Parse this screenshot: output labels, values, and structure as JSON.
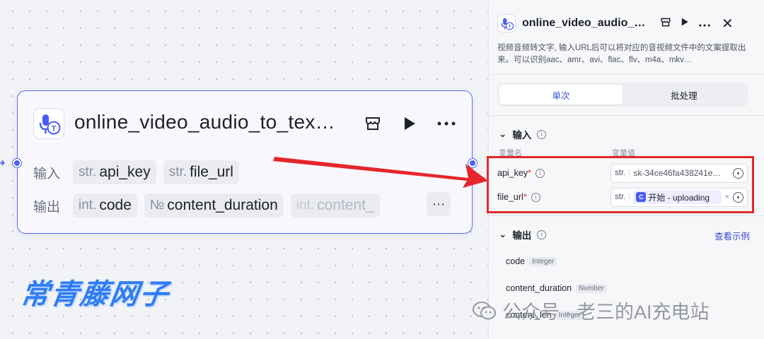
{
  "node": {
    "title": "online_video_audio_to_tex…",
    "input_label": "输入",
    "output_label": "输出",
    "inputs": [
      {
        "type": "str.",
        "name": "api_key"
      },
      {
        "type": "str.",
        "name": "file_url"
      }
    ],
    "outputs": [
      {
        "type": "int.",
        "name": "code"
      },
      {
        "type": "№",
        "name": "content_duration"
      },
      {
        "type": "int.",
        "name": "content_"
      }
    ],
    "more_glyph": "⋯"
  },
  "watermark": {
    "brand": "常青藤网子",
    "account": "公众号 · 老三的AI充电站"
  },
  "panel": {
    "title": "online_video_audio_…",
    "description": "视频音频转文字, 输入URL后可以将对应的音视频文件中的文案提取出来。可以识别aac、amr、avi、flac、flv、m4a、mkv…",
    "tabs": [
      {
        "label": "单次",
        "active": true
      },
      {
        "label": "批处理",
        "active": false
      }
    ],
    "input_section": {
      "title": "输入",
      "col_name": "变量名",
      "col_value": "变量值",
      "params": [
        {
          "name": "api_key",
          "required": "*",
          "type": "str.",
          "value": "sk-34ce46fa438241e…"
        },
        {
          "name": "file_url",
          "required": "*",
          "type": "str.",
          "ref_icon": "C",
          "ref_value": "开始 - uploading",
          "clear": "×"
        }
      ]
    },
    "output_section": {
      "title": "输出",
      "see_example": "查看示例",
      "items": [
        {
          "name": "code",
          "type": "Integer"
        },
        {
          "name": "content_duration",
          "type": "Number"
        },
        {
          "name": "content_len",
          "type": "Integer"
        }
      ]
    }
  },
  "colors": {
    "accent": "#5162f0",
    "highlight": "#e5262b",
    "canvas_bg": "#f2f3f6"
  }
}
